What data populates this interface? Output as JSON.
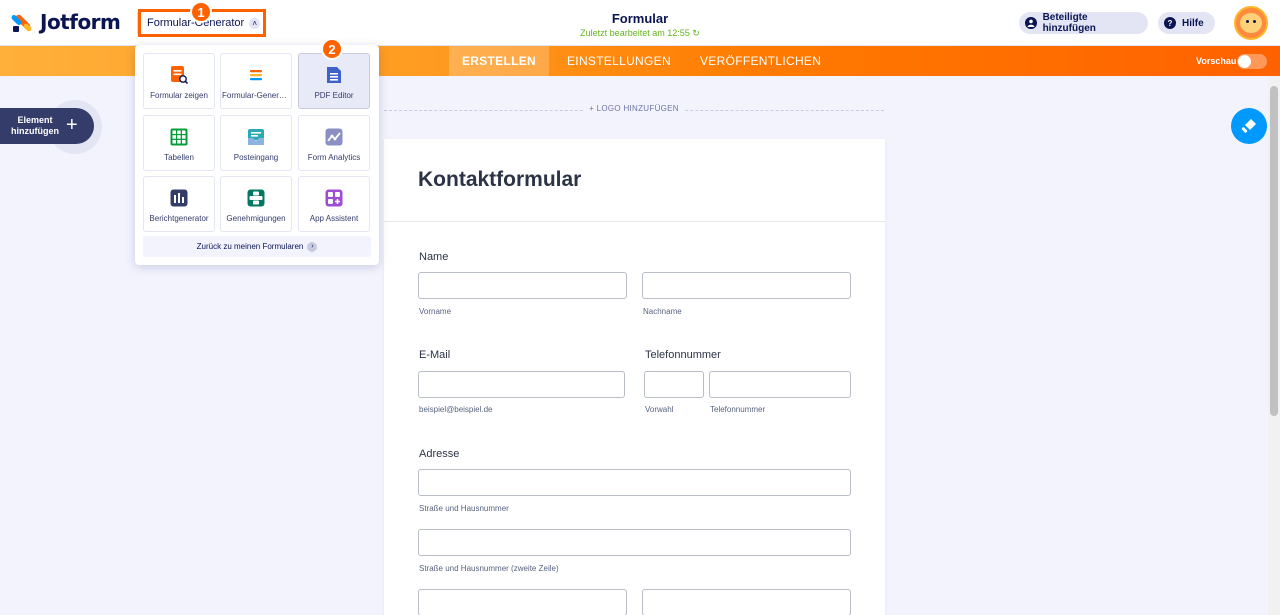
{
  "header": {
    "logo_text": "Jotform",
    "builder_label": "Formular-Generator",
    "form_title": "Formular",
    "last_edited": "Zuletzt bearbeitet am 12:55",
    "invite_label": "Beteiligte hinzufügen",
    "help_label": "Hilfe"
  },
  "steps": {
    "one": "1",
    "two": "2"
  },
  "nav": {
    "tabs": [
      {
        "label": "ERSTELLEN"
      },
      {
        "label": "EINSTELLUNGEN"
      },
      {
        "label": "VERÖFFENTLICHEN"
      }
    ],
    "preview_label": "Vorschau"
  },
  "dropdown": {
    "items": [
      {
        "label": "Formular zeigen",
        "icon": "form-view-icon",
        "color": "#ff6100"
      },
      {
        "label": "Formular-Generator",
        "icon": "form-builder-icon",
        "color": "#ff9a1f"
      },
      {
        "label": "PDF Editor",
        "icon": "pdf-editor-icon",
        "color": "#3e62c8"
      },
      {
        "label": "Tabellen",
        "icon": "tables-icon",
        "color": "#049e38"
      },
      {
        "label": "Posteingang",
        "icon": "inbox-icon",
        "color": "#8ab3e0"
      },
      {
        "label": "Form Analytics",
        "icon": "analytics-icon",
        "color": "#8a8fc4"
      },
      {
        "label": "Berichtgenerator",
        "icon": "report-builder-icon",
        "color": "#343c6a"
      },
      {
        "label": "Genehmigungen",
        "icon": "approvals-icon",
        "color": "#007862"
      },
      {
        "label": "App Assistent",
        "icon": "app-builder-icon",
        "color": "#9c4dd3"
      }
    ],
    "back_label": "Zurück zu meinen Formularen"
  },
  "sidebar": {
    "add_element_label": "Element hinzufügen"
  },
  "canvas": {
    "add_logo_label": "+ LOGO HINZUFÜGEN"
  },
  "form": {
    "title": "Kontaktformular",
    "name_label": "Name",
    "first_name_sub": "Vorname",
    "last_name_sub": "Nachname",
    "email_label": "E-Mail",
    "email_sub": "beispiel@beispiel.de",
    "phone_label": "Telefonnummer",
    "area_code_sub": "Vorwahl",
    "phone_sub": "Telefonnummer",
    "address_label": "Adresse",
    "street_sub": "Straße und Hausnummer",
    "street2_sub": "Straße und Hausnummer (zweite Zeile)"
  },
  "colors": {
    "accent": "#ff6100",
    "brand_dark": "#0a1551",
    "link_blue": "#0099ff"
  }
}
